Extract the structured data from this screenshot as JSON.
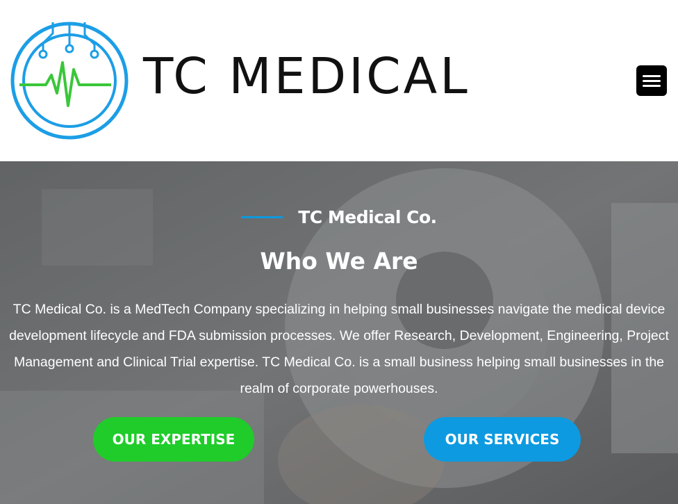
{
  "header": {
    "brand_name": "TC MEDICAL",
    "logo_icon": "circuit-heartbeat-icon",
    "menu_icon": "hamburger-menu-icon"
  },
  "hero": {
    "eyebrow": "TC Medical Co.",
    "title": "Who We Are",
    "description": "TC Medical Co. is a MedTech Company specializing in helping small businesses navigate the medical device development lifecycle and FDA submission processes. We offer Research, Development, Engineering, Project Management and Clinical Trial expertise. TC Medical Co. is a small business helping small businesses in the realm of corporate powerhouses.",
    "buttons": {
      "expertise": "OUR EXPERTISE",
      "services": "OUR SERVICES"
    }
  },
  "colors": {
    "green": "#1fcc2a",
    "blue": "#0d9ae0",
    "logo_blue": "#1c9ee6",
    "logo_green": "#3ac63a"
  }
}
